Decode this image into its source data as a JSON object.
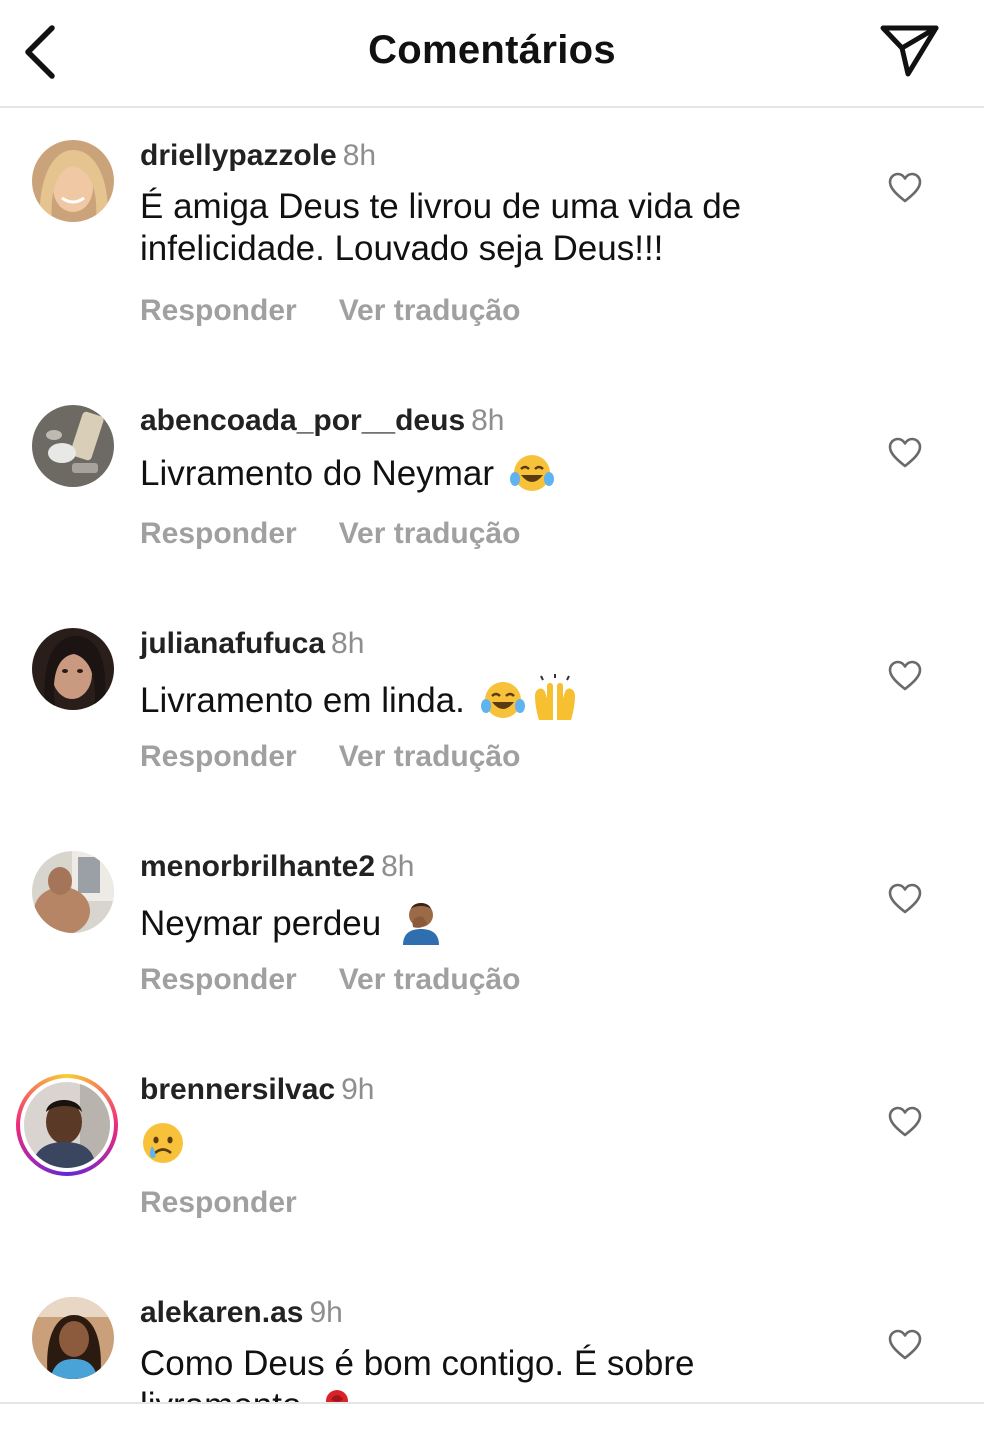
{
  "header": {
    "title": "Comentários",
    "back_icon": "chevron-left-icon",
    "send_icon": "paper-plane-icon"
  },
  "actions": {
    "reply": "Responder",
    "translate": "Ver tradução"
  },
  "comments": [
    {
      "user": "driellypazzole",
      "time": "8h",
      "line1": "É amiga Deus te livrou de uma vida de",
      "line2": "infelicidade. Louvado seja Deus!!!"
    },
    {
      "user": "abencoada_por__deus",
      "time": "8h",
      "line1": "Livramento do Neymar",
      "emoji": "tears-of-joy"
    },
    {
      "user": "julianafufuca",
      "time": "8h",
      "line1": "Livramento em linda.",
      "emoji": "tears-of-joy raising-hands"
    },
    {
      "user": "menorbrilhante2",
      "time": "8h",
      "line1": "Neymar perdeu",
      "emoji": "facepalm"
    },
    {
      "user": "brennersilvac",
      "time": "9h",
      "emoji": "crying-face"
    },
    {
      "user": "alekaren.as",
      "time": "9h",
      "line1": "Como Deus é bom contigo. É sobre",
      "line2": "livramento",
      "emoji": "rose"
    }
  ],
  "colors": {
    "username": "#222222",
    "timestamp": "#8e8e8e",
    "action": "#a0a0a0",
    "divider": "#e6e6e6",
    "story_ring": [
      "#f9ce34",
      "#ee2a7b",
      "#6228d7"
    ]
  }
}
